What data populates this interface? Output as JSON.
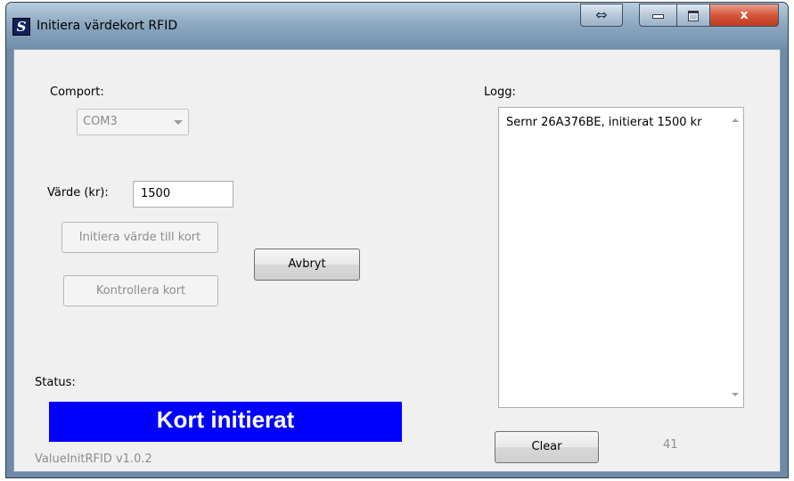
{
  "window": {
    "title": "Initiera värdekort RFID",
    "icon_glyph": "S",
    "controls": {
      "expand_glyph": "⇔",
      "close_glyph": "x"
    }
  },
  "form": {
    "comport_label": "Comport:",
    "comport_value": "COM3",
    "value_label": "Värde (kr):",
    "value_input": "1500",
    "init_button": "Initiera värde till kort",
    "check_button": "Kontrollera kort",
    "cancel_button": "Avbryt"
  },
  "status": {
    "label": "Status:",
    "text": "Kort initierat",
    "color": "#0000ff"
  },
  "log": {
    "label": "Logg:",
    "content": "Sernr 26A376BE, initierat 1500 kr",
    "clear_button": "Clear",
    "count": "41"
  },
  "footer": {
    "version": "ValueInitRFID v1.0.2"
  }
}
